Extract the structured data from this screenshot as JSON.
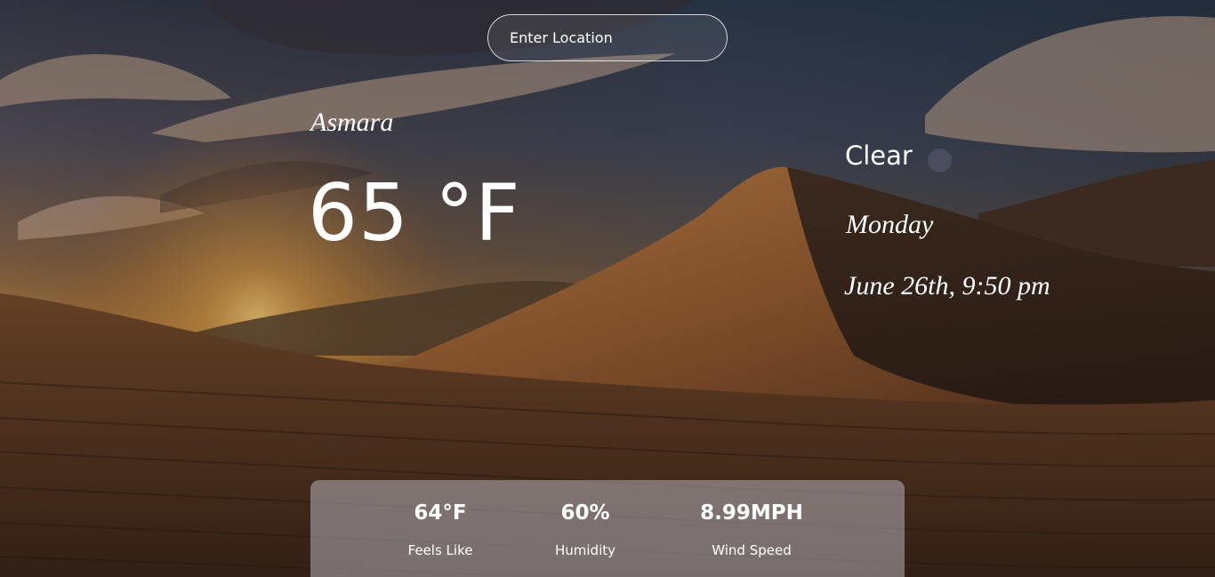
{
  "search": {
    "placeholder": "Enter Location"
  },
  "location": {
    "city": "Asmara"
  },
  "current": {
    "temperature": "65 °F",
    "condition": "Clear",
    "condition_icon": "weather-icon",
    "day": "Monday",
    "datetime": "June 26th, 9:50 pm"
  },
  "stats": {
    "feels_like": {
      "value": "64°F",
      "label": "Feels Like"
    },
    "humidity": {
      "value": "60%",
      "label": "Humidity"
    },
    "wind_speed": {
      "value": "8.99MPH",
      "label": "Wind Speed"
    }
  },
  "colors": {
    "text": "#ffffff",
    "panel": "#bebec8"
  }
}
